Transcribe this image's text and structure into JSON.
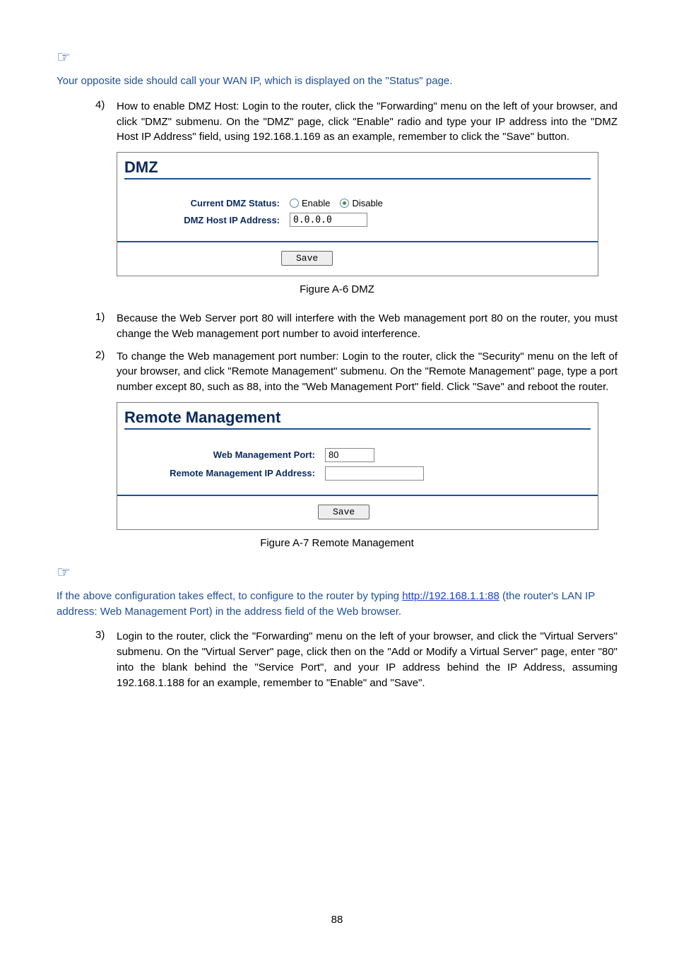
{
  "note1": {
    "text": "Your opposite side should call your WAN IP, which is displayed on the \"Status\" page."
  },
  "item4": {
    "marker": "4)",
    "text": "How to enable DMZ Host: Login to the router, click the \"Forwarding\" menu on the left of your browser, and click \"DMZ\" submenu. On the \"DMZ\" page, click \"Enable\" radio and type your IP address into the \"DMZ Host IP Address\" field, using 192.168.1.169 as an example, remember to click the \"Save\" button."
  },
  "dmz": {
    "title": "DMZ",
    "status_label": "Current DMZ Status:",
    "enable_label": "Enable",
    "disable_label": "Disable",
    "ip_label": "DMZ Host IP Address:",
    "ip_value": "0.0.0.0",
    "save_label": "Save",
    "caption": "Figure A-6 DMZ"
  },
  "item1": {
    "marker": "1)",
    "text": "Because the Web Server port 80 will interfere with the Web management port 80 on the router, you must change the Web management port number to avoid interference."
  },
  "item2": {
    "marker": "2)",
    "text": "To change the Web management port number: Login to the router, click the \"Security\" menu on the left of your browser, and click \"Remote Management\" submenu. On the \"Remote Management\" page, type a port number except 80, such as 88, into the \"Web Management Port\" field. Click \"Save\" and reboot the router."
  },
  "rm": {
    "title": "Remote Management",
    "port_label": "Web Management Port:",
    "port_value": "80",
    "ip_label": "Remote Management IP Address:",
    "ip_value": "",
    "save_label": "Save",
    "caption": "Figure A-7 Remote Management"
  },
  "note2": {
    "prefix": "If the above configuration takes effect, to configure to the router by typing ",
    "link_text": "http://192.168.1.1:88",
    "suffix": " (the router's LAN IP address: Web Management Port) in the address field of the Web browser."
  },
  "item3": {
    "marker": "3)",
    "text": "Login to the router, click the \"Forwarding\" menu on the left of your browser, and click the \"Virtual Servers\" submenu. On the \"Virtual Server\" page, click               then on the \"Add or Modify a Virtual Server\" page, enter \"80\" into the blank behind the \"Service Port\", and your IP address behind the IP Address, assuming 192.168.1.188 for an example, remember to \"Enable\" and \"Save\"."
  },
  "page_number": "88"
}
